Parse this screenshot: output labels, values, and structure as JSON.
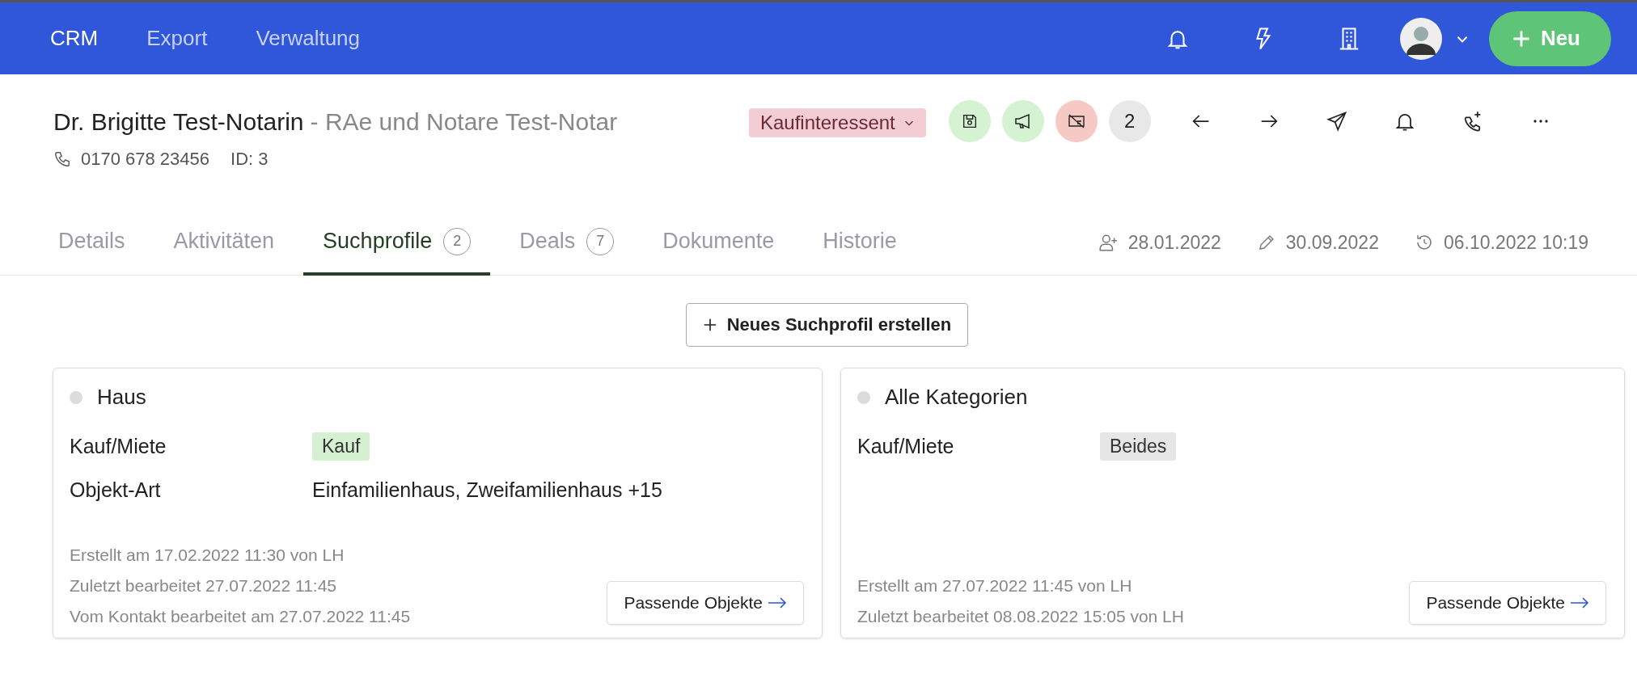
{
  "topbar": {
    "nav": [
      {
        "label": "CRM",
        "selected": true
      },
      {
        "label": "Export",
        "selected": false
      },
      {
        "label": "Verwaltung",
        "selected": false
      }
    ],
    "new_button": "Neu"
  },
  "contact": {
    "name": "Dr. Brigitte Test-Notarin",
    "company": "- RAe und Notare Test-Notar",
    "phone": "0170 678 23456",
    "id": "ID: 3",
    "status": "Kaufinteressent",
    "quick_actions": [
      {
        "kind": "save",
        "color": "#d5f3d3"
      },
      {
        "kind": "megaphone",
        "color": "#d5f3d3"
      },
      {
        "kind": "card-off",
        "color": "#f7c9c4"
      },
      {
        "kind": "count",
        "text": "2",
        "color": "#e8e8e8"
      }
    ]
  },
  "tabs": [
    {
      "label": "Details",
      "selected": false
    },
    {
      "label": "Aktivitäten",
      "selected": false
    },
    {
      "label": "Suchprofile",
      "count": "2",
      "selected": true
    },
    {
      "label": "Deals",
      "count": "7",
      "selected": false
    },
    {
      "label": "Dokumente",
      "selected": false
    },
    {
      "label": "Historie",
      "selected": false
    }
  ],
  "dates": {
    "created": "28.01.2022",
    "edited": "30.09.2022",
    "history": "06.10.2022 10:19"
  },
  "create_button": "Neues Suchprofil erstellen",
  "profiles": [
    {
      "title": "Haus",
      "fields": [
        {
          "label": "Kauf/Miete",
          "kind": "tag",
          "value": "Kauf",
          "color": "#d6f0d2"
        },
        {
          "label": "Objekt-Art",
          "kind": "text",
          "value": "Einfamilienhaus, Zweifamilienhaus +15"
        }
      ],
      "meta": [
        "Erstellt am 17.02.2022 11:30 von LH",
        "Zuletzt bearbeitet 27.07.2022 11:45",
        "Vom Kontakt bearbeitet am 27.07.2022 11:45"
      ],
      "button": "Passende Objekte"
    },
    {
      "title": "Alle Kategorien",
      "fields": [
        {
          "label": "Kauf/Miete",
          "kind": "tag",
          "value": "Beides",
          "color": "#e6e6e6"
        }
      ],
      "meta": [
        "Erstellt am 27.07.2022 11:45 von LH",
        "Zuletzt bearbeitet 08.08.2022 15:05 von LH"
      ],
      "button": "Passende Objekte"
    }
  ]
}
